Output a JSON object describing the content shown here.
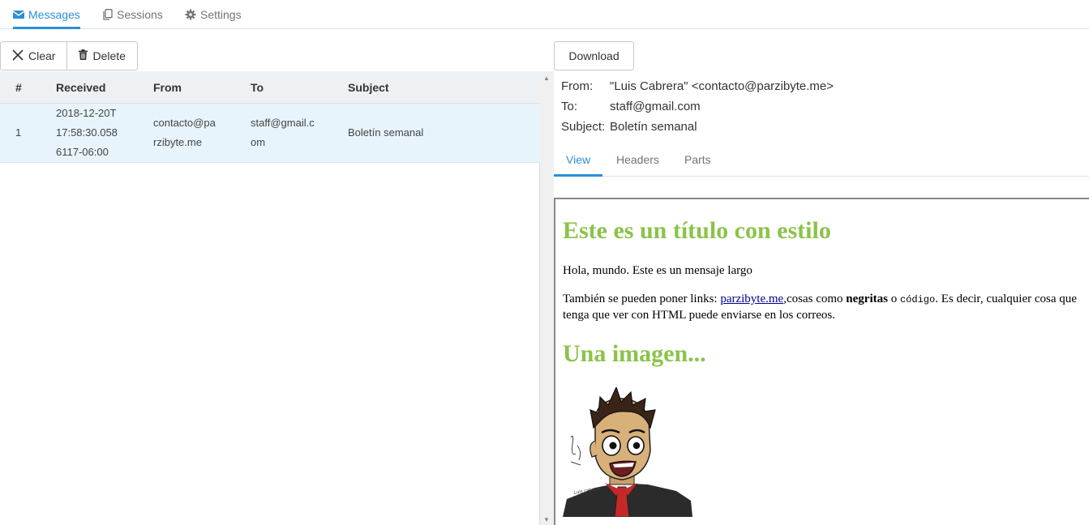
{
  "topnav": {
    "tabs": [
      {
        "label": "Messages",
        "icon": "envelope-icon",
        "active": true
      },
      {
        "label": "Sessions",
        "icon": "copy-icon",
        "active": false
      },
      {
        "label": "Settings",
        "icon": "gear-icon",
        "active": false
      }
    ]
  },
  "toolbar": {
    "clear_label": "Clear",
    "delete_label": "Delete",
    "download_label": "Download"
  },
  "table": {
    "headers": [
      "#",
      "Received",
      "From",
      "To",
      "Subject"
    ],
    "rows": [
      {
        "num": "1",
        "received_lines": [
          "2018-12-20T",
          "17:58:30.058",
          "6117-06:00"
        ],
        "from_lines": [
          "contacto@pa",
          "rzibyte.me"
        ],
        "to_lines": [
          "staff@gmail.c",
          "om"
        ],
        "subject": "Boletín semanal"
      }
    ]
  },
  "message": {
    "from_label": "From:",
    "from_value": "\"Luis Cabrera\" <contacto@parzibyte.me>",
    "to_label": "To:",
    "to_value": "staff@gmail.com",
    "subject_label": "Subject:",
    "subject_value": "Boletín semanal",
    "tabs": [
      "View",
      "Headers",
      "Parts"
    ],
    "active_tab": "View"
  },
  "preview": {
    "heading1": "Este es un título con estilo",
    "para1": "Hola, mundo. Este es un mensaje largo",
    "para2_prefix": "También se pueden poner links: ",
    "para2_link": "parzibyte.me",
    "para2_mid": ",cosas como ",
    "para2_bold": "negritas",
    "para2_or": " o ",
    "para2_code": "código",
    "para2_suffix": ". Es decir, cualquier cosa que tenga que ver con HTML puede enviarse en los correos.",
    "heading2": "Una imagen...",
    "image_signature": "Luis Cabrera"
  },
  "colors": {
    "accent": "#2b8fd6",
    "heading_green": "#8bc34a",
    "selected_row": "#e8f4fc",
    "header_bg": "#eef1f4"
  }
}
